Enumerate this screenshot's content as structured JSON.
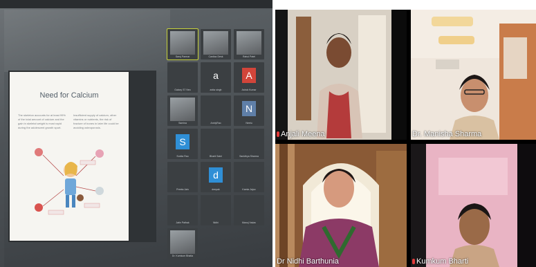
{
  "slide": {
    "title": "Need for Calcium",
    "left_text": "The skeleton accounts for at least 99% of the total amount of calcium and the gain in skeletal weight is most rapid during the adolescent growth spurt.",
    "right_text": "Insufficient supply of calcium, other vitamins or nutrients, the risk of fracture of bones in later life could be avoiding osteoporosis."
  },
  "participants": [
    {
      "name": "Saroj Parmar",
      "avatar": "",
      "kind": "photo",
      "active": true
    },
    {
      "name": "Cardiac Desk",
      "avatar": "",
      "kind": "photo",
      "active": false
    },
    {
      "name": "Rahul Patel",
      "avatar": "",
      "kind": "photo",
      "active": false
    },
    {
      "name": "Galaxy S7 Neo",
      "avatar": "",
      "kind": "text",
      "active": false
    },
    {
      "name": "anita singh",
      "avatar": "a",
      "kind": "letter",
      "color": "#3b3f42",
      "active": false
    },
    {
      "name": "Ashok Kumar",
      "avatar": "A",
      "kind": "letter",
      "color": "#d2453a",
      "active": false
    },
    {
      "name": "Samina",
      "avatar": "",
      "kind": "photo",
      "active": false
    },
    {
      "name": "AnniyRao",
      "avatar": "",
      "kind": "text",
      "active": false
    },
    {
      "name": "Neetu",
      "avatar": "N",
      "kind": "letter",
      "color": "#5f7fa8",
      "active": false
    },
    {
      "name": "Sunita Rao",
      "avatar": "S",
      "kind": "letter",
      "color": "#2f8fd6",
      "active": false
    },
    {
      "name": "Bharti Saini",
      "avatar": "",
      "kind": "text",
      "active": false
    },
    {
      "name": "Sanidhya Sharma",
      "avatar": "",
      "kind": "text",
      "active": false
    },
    {
      "name": "Preeta Jain",
      "avatar": "",
      "kind": "text",
      "active": false
    },
    {
      "name": "deepak",
      "avatar": "d",
      "kind": "letter",
      "color": "#2f8fd6",
      "active": false
    },
    {
      "name": "Kamla Jajoo",
      "avatar": "",
      "kind": "text",
      "active": false
    },
    {
      "name": "Jatin Pathak",
      "avatar": "",
      "kind": "text",
      "active": false
    },
    {
      "name": "Nidhi",
      "avatar": "",
      "kind": "text",
      "active": false
    },
    {
      "name": "Manoj Yadav",
      "avatar": "",
      "kind": "text",
      "active": false
    },
    {
      "name": "Dr. Kumkum Bhatia",
      "avatar": "",
      "kind": "photo",
      "active": false
    }
  ],
  "videos": [
    {
      "name": "Anjali Meena",
      "mic_muted": true
    },
    {
      "name": "Dr. Manisha Sharma",
      "mic_muted": false
    },
    {
      "name": "Dr Nidhi Barthunia",
      "mic_muted": false
    },
    {
      "name": "Kumkum Bharti",
      "mic_muted": true
    }
  ],
  "colors": {
    "active_speaker_outline": "#c8d33a",
    "muted_mic": "#e23b3b"
  }
}
